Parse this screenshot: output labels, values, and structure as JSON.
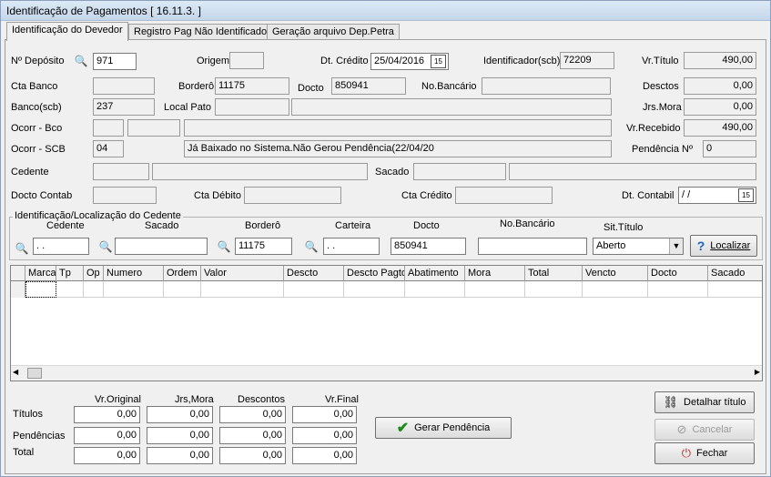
{
  "window": {
    "title": "Identificação de Pagamentos  [ 16.11.3. ]"
  },
  "tabs": [
    "Identificação do Devedor",
    "Registro Pag Não Identificado",
    "Geração arquivo Dep.Petra"
  ],
  "form": {
    "n_deposito": {
      "label": "Nº Depósito",
      "value": "971"
    },
    "origem": {
      "label": "Origem",
      "value": ""
    },
    "dt_credito": {
      "label": "Dt. Crédito",
      "value": "25/04/2016"
    },
    "identificador": {
      "label": "Identificador(scb)",
      "value": "72209"
    },
    "vr_titulo": {
      "label": "Vr.Título",
      "value": "490,00"
    },
    "cta_banco": {
      "label": "Cta Banco",
      "value": ""
    },
    "bordero": {
      "label": "Borderô",
      "value": "11175"
    },
    "docto": {
      "label": "Docto",
      "value": "850941"
    },
    "no_bancario": {
      "label": "No.Bancário",
      "value": ""
    },
    "desctos": {
      "label": "Desctos",
      "value": "0,00"
    },
    "banco_scb": {
      "label": "Banco(scb)",
      "value": "237"
    },
    "local_pato": {
      "label": "Local Pato",
      "value": ""
    },
    "jrs_mora": {
      "label": "Jrs.Mora",
      "value": "0,00"
    },
    "ocorr_bco": {
      "label": "Ocorr - Bco",
      "value": ""
    },
    "vr_recebido": {
      "label": "Vr.Recebido",
      "value": "490,00"
    },
    "ocorr_scb": {
      "label": "Ocorr - SCB",
      "code": "04",
      "text": "Já Baixado no Sistema.Não Gerou Pendência(22/04/20"
    },
    "pendencia": {
      "label": "Pendência Nº",
      "value": "0"
    },
    "cedente": {
      "label": "Cedente",
      "value": ""
    },
    "sacado": {
      "label": "Sacado",
      "value": ""
    },
    "docto_contab": {
      "label": "Docto Contab",
      "value": ""
    },
    "cta_debito": {
      "label": "Cta Débito",
      "value": ""
    },
    "cta_credito": {
      "label": "Cta Crédito",
      "value": ""
    },
    "dt_contabil": {
      "label": "Dt. Contabil",
      "value": " / /"
    }
  },
  "search": {
    "group_title": "Identificação/Localização do Cedente",
    "cedente": {
      "label": "Cedente",
      "value": " .  ."
    },
    "sacado": {
      "label": "Sacado",
      "value": ""
    },
    "bordero": {
      "label": "Borderô",
      "value": "11175"
    },
    "carteira": {
      "label": "Carteira",
      "value": " .  ."
    },
    "docto": {
      "label": "Docto",
      "value": "850941"
    },
    "no_bancario": {
      "label": "No.Bancário",
      "value": ""
    },
    "sit_titulo": {
      "label": "Sit.Título",
      "value": "Aberto"
    },
    "localizar": "Localizar"
  },
  "grid": {
    "columns": [
      "Marca",
      "Tp",
      "Op",
      "Numero",
      "Ordem",
      "Valor",
      "Descto",
      "Descto Pagto",
      "Abatimento",
      "Mora",
      "Total",
      "Vencto",
      "Docto",
      "Sacado"
    ]
  },
  "totals": {
    "headers": [
      "Vr.Original",
      "Jrs,Mora",
      "Descontos",
      "Vr.Final"
    ],
    "rows": [
      {
        "label": "Títulos",
        "values": [
          "0,00",
          "0,00",
          "0,00",
          "0,00"
        ]
      },
      {
        "label": "Pendências",
        "values": [
          "0,00",
          "0,00",
          "0,00",
          "0,00"
        ]
      },
      {
        "label": "Total",
        "values": [
          "0,00",
          "0,00",
          "0,00",
          "0,00"
        ]
      }
    ]
  },
  "buttons": {
    "gerar": "Gerar Pendência",
    "detalhar": "Detalhar título",
    "cancelar": "Cancelar",
    "fechar": "Fechar"
  },
  "icons": {
    "lookup": "binoculars-icon",
    "calendar": "calendar-icon",
    "check": "check-icon",
    "help": "question-icon",
    "detail": "hierarchy-icon",
    "cancel": "cancel-icon",
    "close": "close-icon"
  },
  "colors": {
    "check": "#1a8a1a",
    "help": "#1565c0",
    "close": "#c62828",
    "title_bg": "#c4d6ea"
  }
}
